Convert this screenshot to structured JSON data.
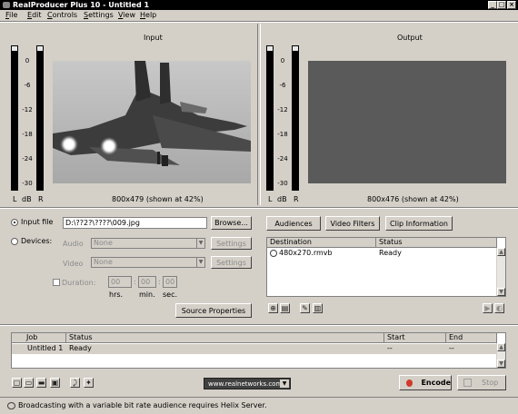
{
  "window": {
    "title": "RealProducer Plus 10 - Untitled 1"
  },
  "menu": [
    "File",
    "Edit",
    "Controls",
    "Settings",
    "View",
    "Help"
  ],
  "input_panel": {
    "header": "Input",
    "scale": [
      "0",
      "-6",
      "-12",
      "-18",
      "-24",
      "-30"
    ],
    "meter_labels": {
      "left": "L",
      "db": "dB",
      "right": "R"
    },
    "dimensions": "800x479 (shown at 42%)"
  },
  "output_panel": {
    "header": "Output",
    "scale": [
      "0",
      "-6",
      "-12",
      "-18",
      "-24",
      "-30"
    ],
    "meter_labels": {
      "left": "L",
      "db": "dB",
      "right": "R"
    },
    "dimensions": "800x476 (shown at 42%)"
  },
  "source": {
    "input_file_label": "Input file",
    "input_file_value": "D:\\??2?\\????\\009.jpg",
    "browse_label": "Browse...",
    "devices_label": "Devices:",
    "audio_label": "Audio",
    "audio_value": "None",
    "video_label": "Video",
    "video_value": "None",
    "settings_label": "Settings",
    "duration_label": "Duration:",
    "duration_hrs": "00",
    "duration_min": "00",
    "duration_sec": "00",
    "units": {
      "hrs": "hrs.",
      "min": "min.",
      "sec": "sec."
    },
    "source_properties_label": "Source Properties"
  },
  "destination": {
    "audiences_label": "Audiences",
    "video_filters_label": "Video Filters",
    "clip_information_label": "Clip Information",
    "columns": [
      "Destination",
      "Status"
    ],
    "rows": [
      {
        "destination": "480x270.rmvb",
        "status": "Ready"
      }
    ]
  },
  "jobs": {
    "columns": [
      "Job",
      "Status",
      "Start",
      "End"
    ],
    "rows": [
      {
        "job": "Untitled 1",
        "status": "Ready",
        "start": "--",
        "end": "--"
      }
    ]
  },
  "bottom_bar": {
    "url": "www.realnetworks.com",
    "encode_label": "Encode",
    "stop_label": "Stop"
  },
  "status_message": "Broadcasting with a variable bit rate audience requires Helix Server.",
  "colors": {
    "title_bg": "#000000",
    "window_bg": "#d4d0c8",
    "encode_dot": "#d03a2a",
    "video_bg": "#5a5a5a"
  }
}
